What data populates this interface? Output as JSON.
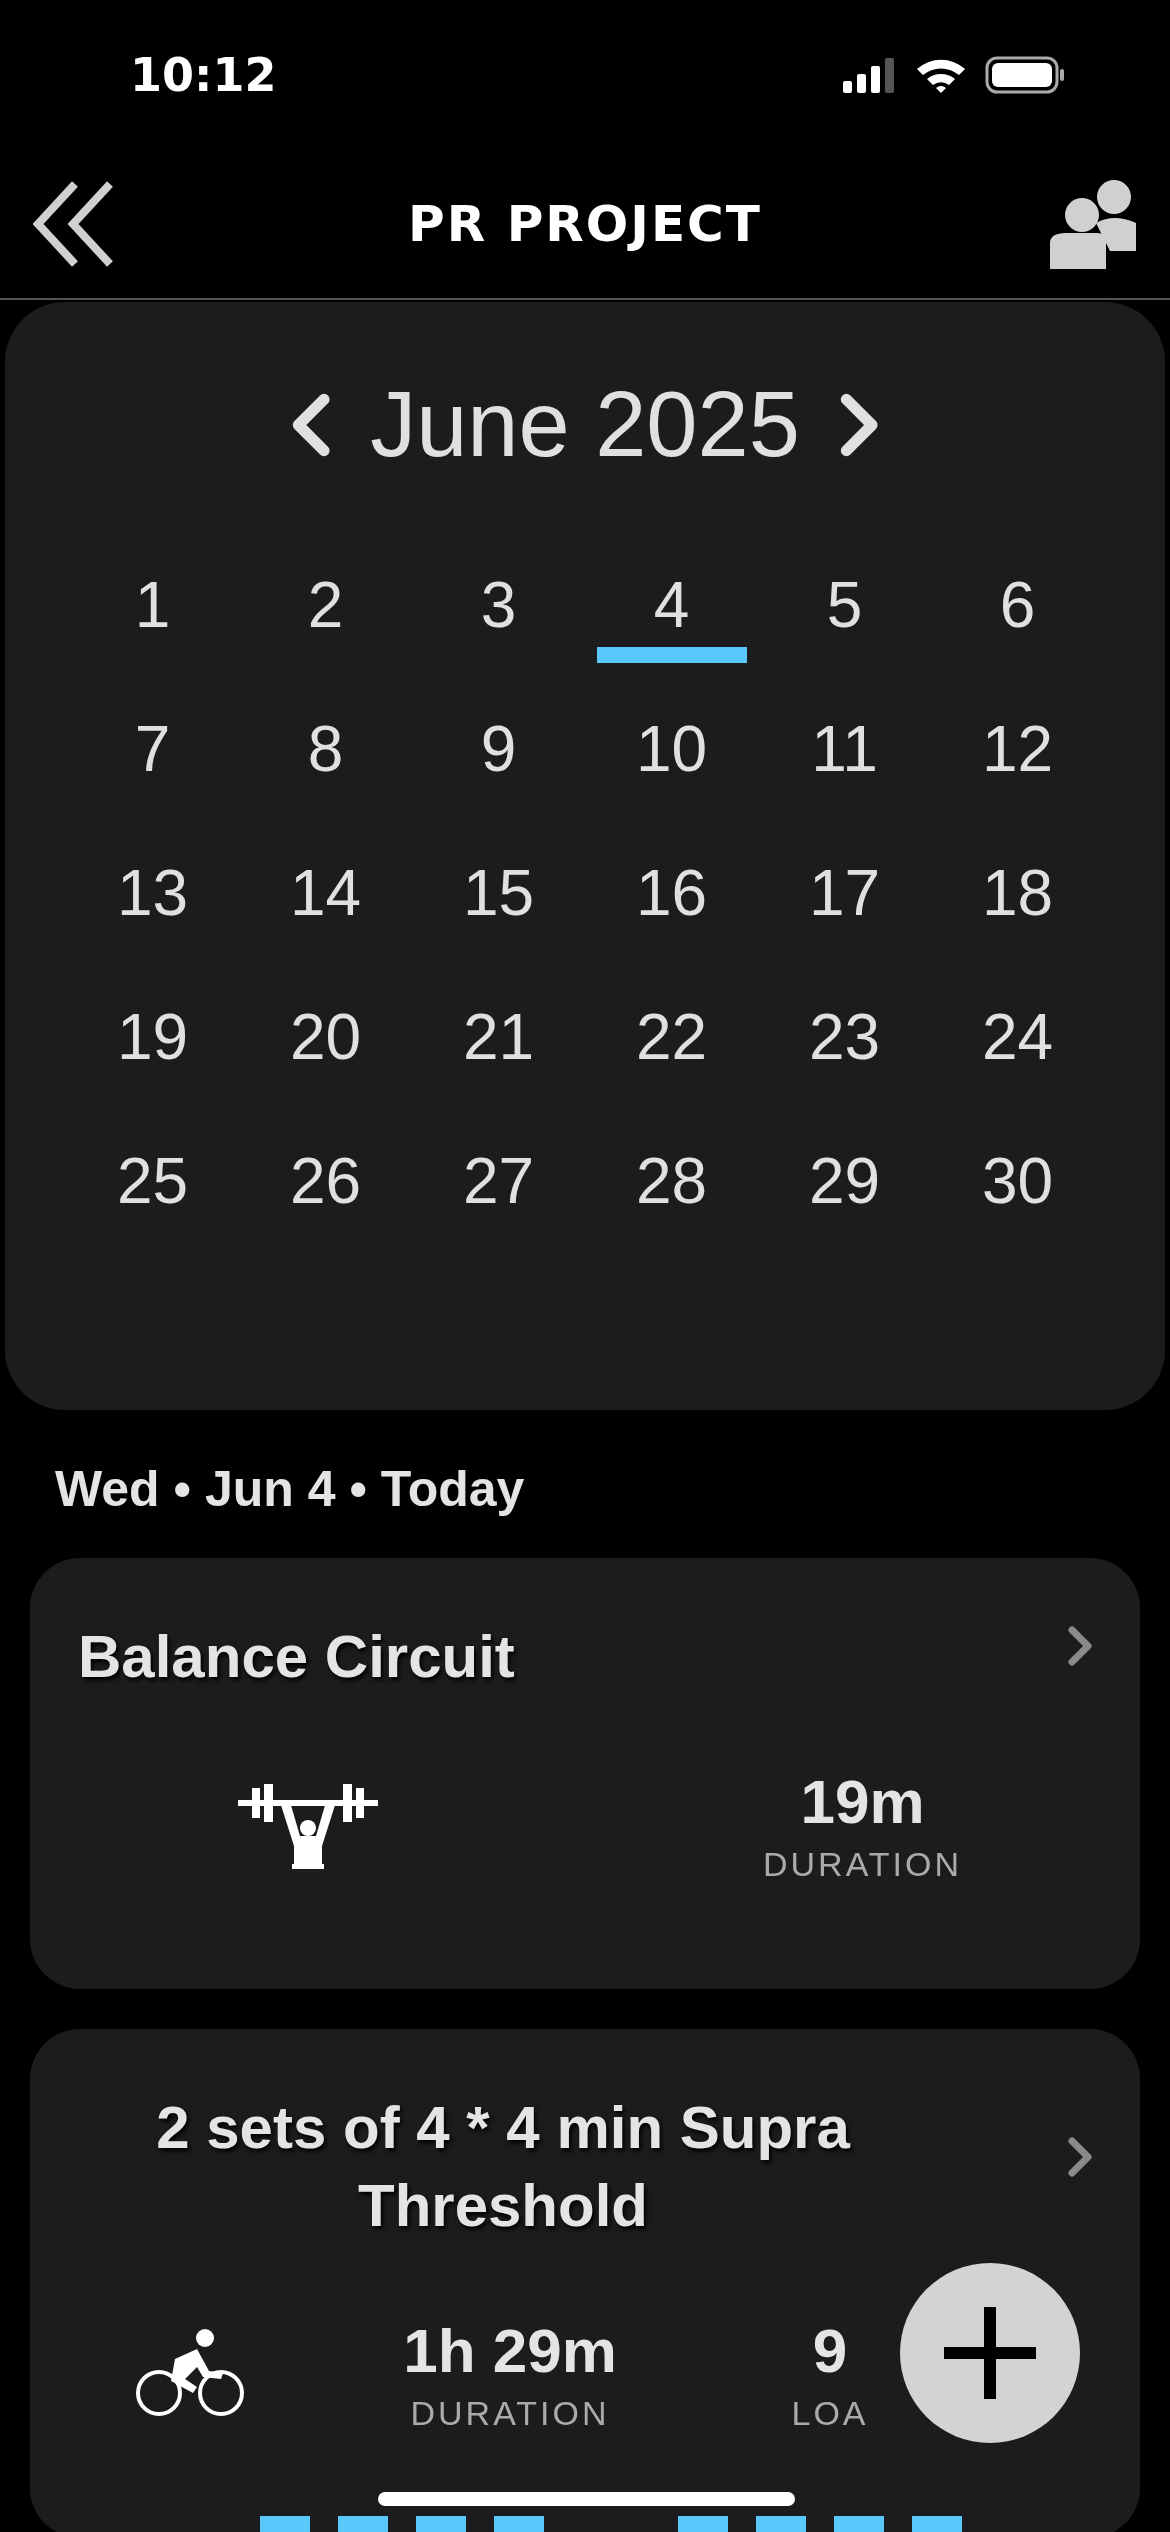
{
  "status_bar": {
    "time": "10:12"
  },
  "nav": {
    "title": "PR PROJECT"
  },
  "calendar": {
    "month": "June 2025",
    "days": [
      {
        "label": "1",
        "selected": false
      },
      {
        "label": "2",
        "selected": false
      },
      {
        "label": "3",
        "selected": false
      },
      {
        "label": "4",
        "selected": true
      },
      {
        "label": "5",
        "selected": false
      },
      {
        "label": "6",
        "selected": false
      },
      {
        "label": "7",
        "selected": false
      },
      {
        "label": "8",
        "selected": false
      },
      {
        "label": "9",
        "selected": false
      },
      {
        "label": "10",
        "selected": false
      },
      {
        "label": "11",
        "selected": false
      },
      {
        "label": "12",
        "selected": false
      },
      {
        "label": "13",
        "selected": false
      },
      {
        "label": "14",
        "selected": false
      },
      {
        "label": "15",
        "selected": false
      },
      {
        "label": "16",
        "selected": false
      },
      {
        "label": "17",
        "selected": false
      },
      {
        "label": "18",
        "selected": false
      },
      {
        "label": "19",
        "selected": false
      },
      {
        "label": "20",
        "selected": false
      },
      {
        "label": "21",
        "selected": false
      },
      {
        "label": "22",
        "selected": false
      },
      {
        "label": "23",
        "selected": false
      },
      {
        "label": "24",
        "selected": false
      },
      {
        "label": "25",
        "selected": false
      },
      {
        "label": "26",
        "selected": false
      },
      {
        "label": "27",
        "selected": false
      },
      {
        "label": "28",
        "selected": false
      },
      {
        "label": "29",
        "selected": false
      },
      {
        "label": "30",
        "selected": false
      }
    ]
  },
  "date_heading": "Wed • Jun 4 • Today",
  "workouts": [
    {
      "title": "Balance Circuit",
      "kind": "strength",
      "stats": [
        {
          "value": "19m",
          "label": "DURATION"
        }
      ]
    },
    {
      "title": "2 sets of 4 * 4 min Supra Threshold",
      "kind": "cycling",
      "stats": [
        {
          "value": "1h 29m",
          "label": "DURATION"
        },
        {
          "value": "9",
          "label": "LOA"
        }
      ]
    }
  ]
}
